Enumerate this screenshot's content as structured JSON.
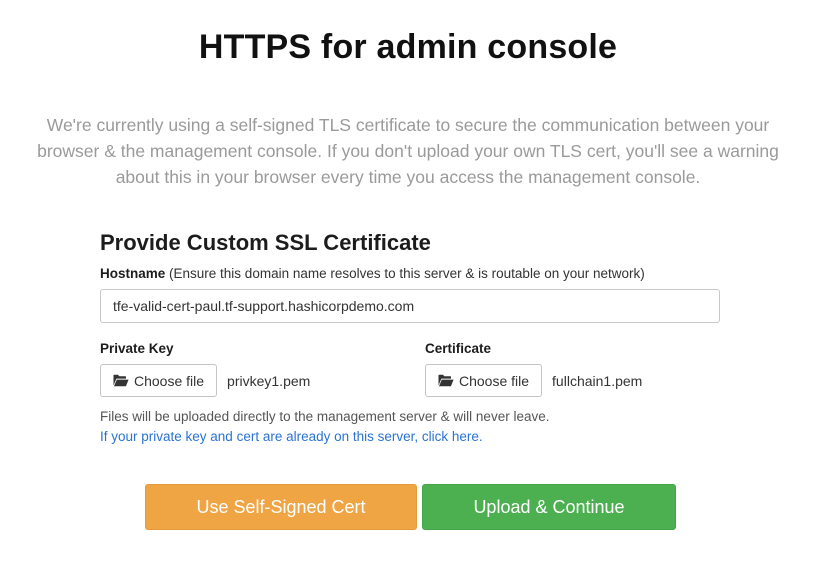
{
  "page": {
    "title": "HTTPS for admin console",
    "intro": "We're currently using a self-signed TLS certificate to secure the communication between your browser & the management console. If you don't upload your own TLS cert, you'll see a warning about this in your browser every time you access the management console."
  },
  "form": {
    "section_title": "Provide Custom SSL Certificate",
    "hostname": {
      "label": "Hostname",
      "hint": "(Ensure this domain name resolves to this server & is routable on your network)",
      "value": "tfe-valid-cert-paul.tf-support.hashicorpdemo.com"
    },
    "private_key": {
      "label": "Private Key",
      "button_label": "Choose file",
      "file_name": "privkey1.pem"
    },
    "certificate": {
      "label": "Certificate",
      "button_label": "Choose file",
      "file_name": "fullchain1.pem"
    },
    "upload_note": "Files will be uploaded directly to the management server & will never leave.",
    "server_link": "If your private key and cert are already on this server, click here."
  },
  "actions": {
    "self_signed_label": "Use Self-Signed Cert",
    "upload_label": "Upload & Continue"
  },
  "colors": {
    "self_signed_button": "#f0a545",
    "upload_button": "#4cb050",
    "link": "#2a73d3",
    "intro_text": "#9a9a9a"
  },
  "icons": {
    "choose_file": "folder-open-icon"
  }
}
